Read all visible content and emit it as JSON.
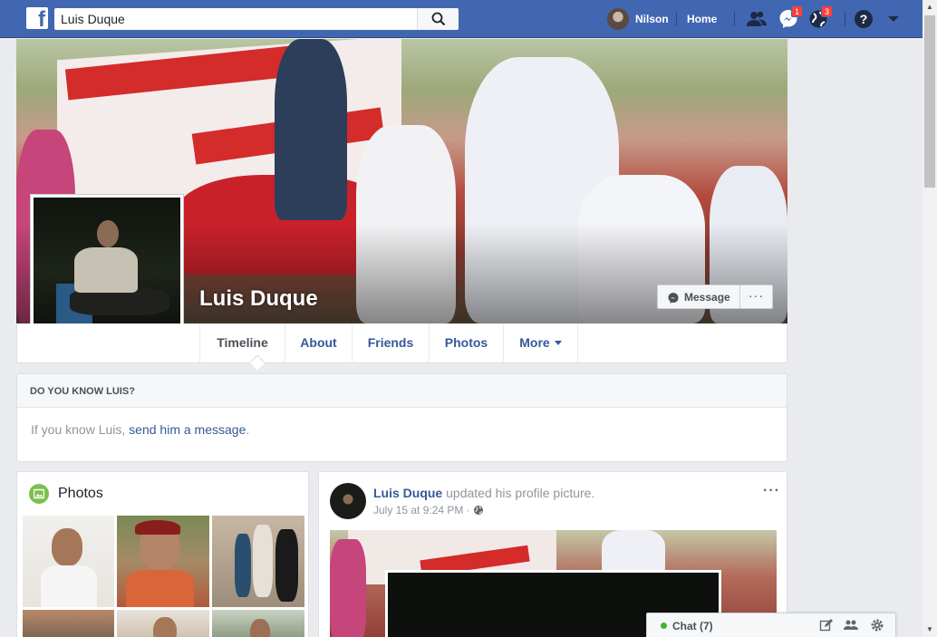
{
  "header": {
    "search_value": "Luis Duque",
    "user_name": "Nilson",
    "home_label": "Home",
    "messages_badge": "1",
    "notifications_badge": "3",
    "brand_color": "#4267b2"
  },
  "profile": {
    "name": "Luis Duque",
    "message_button": "Message",
    "more_button": "···"
  },
  "tabs": [
    {
      "label": "Timeline"
    },
    {
      "label": "About"
    },
    {
      "label": "Friends"
    },
    {
      "label": "Photos"
    },
    {
      "label": "More"
    }
  ],
  "know_box": {
    "title": "DO YOU KNOW LUIS?",
    "text_prefix": "If you know Luis, ",
    "link": "send him a message",
    "text_suffix": "."
  },
  "photos": {
    "title": "Photos"
  },
  "post": {
    "author": "Luis Duque",
    "action": " updated his profile picture.",
    "time": "July 15 at 9:24 PM",
    "separator": " · ",
    "privacy_icon": "globe-icon",
    "options": "···"
  },
  "chat": {
    "label": "Chat (7)"
  },
  "scrollbar": {
    "up_arrow": "▲",
    "down_arrow": "▼"
  }
}
